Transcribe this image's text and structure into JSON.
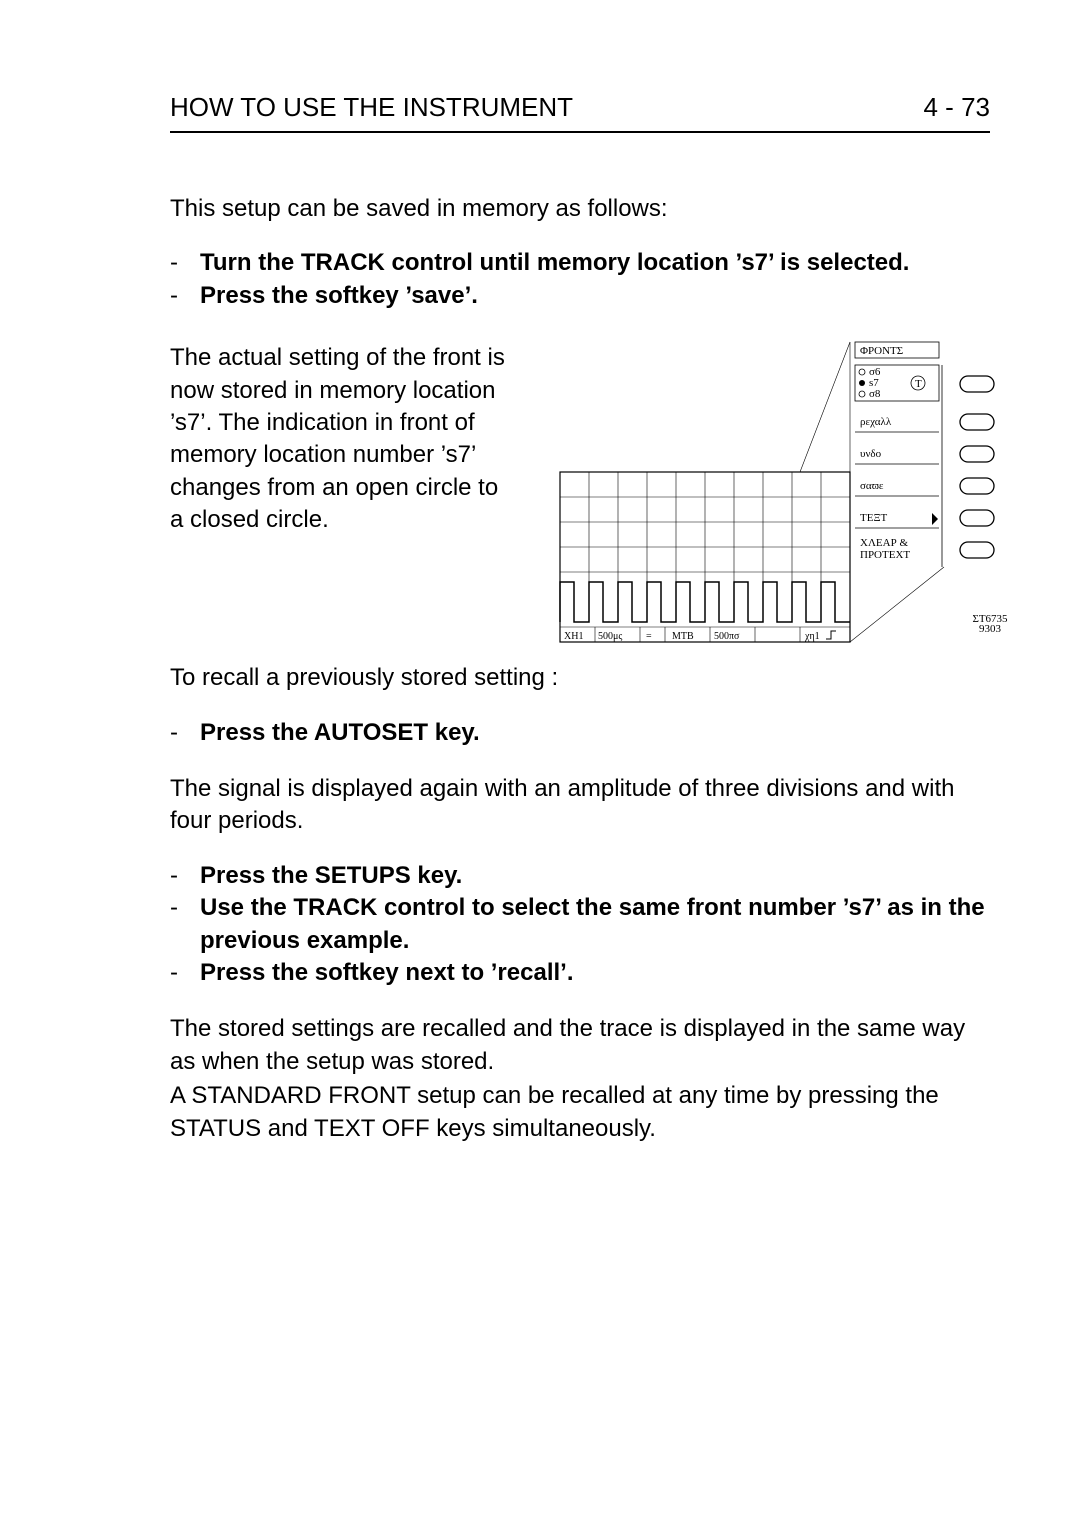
{
  "header": {
    "title": "HOW TO USE THE INSTRUMENT",
    "page": "4 - 73"
  },
  "p1": "This setup can be saved in memory as follows:",
  "bullets1": {
    "b1": "Turn the TRACK control until memory location ’s7’ is selected.",
    "b2": "Press the softkey ’save’."
  },
  "midleft": "The actual setting of the front is now stored in memory location ’s7’. The indication in front of memory location number ’s7’ changes from an open circle to a closed circle.",
  "p2": "To recall a previously stored setting :",
  "bullets2": {
    "b1": "Press the AUTOSET key."
  },
  "p3": "The signal is displayed again with an amplitude of three divisions and with four periods.",
  "bullets3": {
    "b1": "Press the SETUPS key.",
    "b2": "Use the TRACK control to select the same front number ’s7’ as in the previous example.",
    "b3": "Press the softkey next to ’recall’."
  },
  "p4a": "The stored settings are recalled and the trace is displayed in the same way as when the setup was stored.",
  "p4b": "A STANDARD FRONT setup can be recalled at any time by pressing the STATUS and TEXT OFF keys simultaneously.",
  "diagram": {
    "menuHeader": "ΦΡΟΝΤΣ",
    "memOpts": {
      "s6": "σ6",
      "s7": "s7",
      "s8": "σ8",
      "track": "T"
    },
    "items": {
      "recall": "ρεχαλλ",
      "undo": "υνδο",
      "save": "σαϖε",
      "text": "ΤΕΞΤ",
      "clear": "ΧΛΕΑΡ &",
      "protect": "ΠΡΟΤΕΧΤ"
    },
    "bottom": {
      "ch1": "ΧΗ1",
      "v": "500μς",
      "mtb": "ΜΤΒ",
      "t": "500πσ",
      "trig": "χη1"
    },
    "stcode": {
      "line1": "ΣΤ6735",
      "line2": "9303"
    }
  }
}
